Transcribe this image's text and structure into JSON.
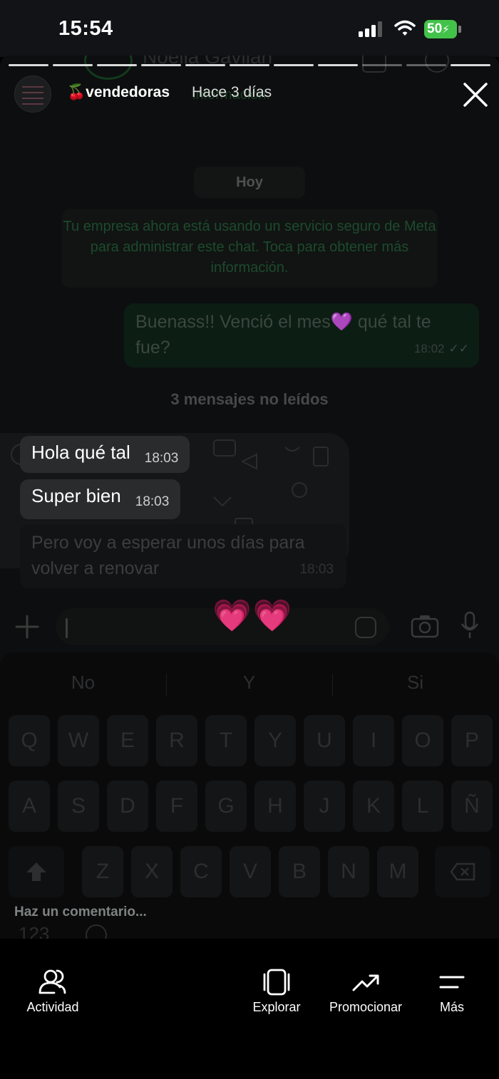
{
  "status_bar": {
    "time": "15:54",
    "battery_level": "50"
  },
  "chat_background": {
    "contact_name": "Noelia Gavilan",
    "header_subtitle": "información.",
    "day_label": "Hoy",
    "system_message": "Tu empresa ahora está usando un servicio seguro de Meta para administrar este chat. Toca para obtener más información.",
    "outgoing": {
      "text": "Buenass!! Venció el mes💜 qué tal te fue?",
      "time": "18:02"
    },
    "unread_label": "3 mensajes no leídos",
    "incoming": [
      {
        "text": "Hola qué tal",
        "time": "18:03"
      },
      {
        "text": "Super bien",
        "time": "18:03"
      },
      {
        "text": "Pero voy a esperar unos días para volver a renovar",
        "time": "18:03"
      }
    ],
    "keyboard": {
      "suggestions": [
        "No",
        "Y",
        "Si"
      ],
      "row1": [
        "Q",
        "W",
        "E",
        "R",
        "T",
        "Y",
        "U",
        "I",
        "O",
        "P"
      ],
      "row2": [
        "A",
        "S",
        "D",
        "F",
        "G",
        "H",
        "J",
        "K",
        "L",
        "Ñ"
      ],
      "row3": [
        "Z",
        "X",
        "C",
        "V",
        "B",
        "N",
        "M"
      ],
      "numbers_key": "123"
    }
  },
  "story": {
    "username": "🍒vendedoras",
    "posted_ago": "Hace 3 días",
    "sticker_text": "💗💗",
    "comment_placeholder": "Haz un comentario..."
  },
  "nav": {
    "activity": "Actividad",
    "explore": "Explorar",
    "promote": "Promocionar",
    "more": "Más"
  },
  "colors": {
    "battery": "#43c24a",
    "background": "#0d0e0f",
    "incoming_bubble": "#2a2b2d",
    "outgoing_bubble": "#0c1d14"
  }
}
